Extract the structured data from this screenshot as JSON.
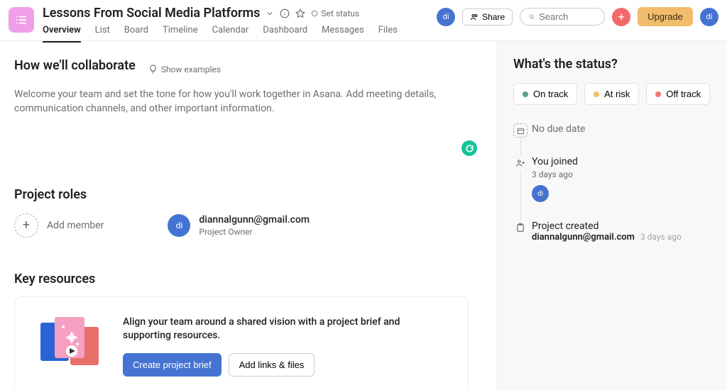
{
  "header": {
    "title": "Lessons From Social Media Platforms",
    "set_status": "Set status",
    "share": "Share",
    "search_placeholder": "Search",
    "upgrade": "Upgrade",
    "avatar_initials": "di"
  },
  "tabs": [
    "Overview",
    "List",
    "Board",
    "Timeline",
    "Calendar",
    "Dashboard",
    "Messages",
    "Files"
  ],
  "active_tab": 0,
  "collab": {
    "heading": "How we'll collaborate",
    "show_examples": "Show examples",
    "placeholder": "Welcome your team and set the tone for how you'll work together in Asana. Add meeting details, communication channels, and other important information."
  },
  "roles": {
    "heading": "Project roles",
    "add_member": "Add member",
    "members": [
      {
        "initials": "di",
        "email": "diannalgunn@gmail.com",
        "role": "Project Owner"
      }
    ]
  },
  "resources": {
    "heading": "Key resources",
    "blurb": "Align your team around a shared vision with a project brief and supporting resources.",
    "create_brief": "Create project brief",
    "add_links": "Add links & files"
  },
  "status": {
    "heading": "What's the status?",
    "options": [
      {
        "label": "On track",
        "color": "#58a182"
      },
      {
        "label": "At risk",
        "color": "#f1bd6c"
      },
      {
        "label": "Off track",
        "color": "#ef7872"
      }
    ],
    "timeline": {
      "no_due": "No due date",
      "joined_title": "You joined",
      "joined_ago": "3 days ago",
      "joined_initials": "di",
      "created_title": "Project created",
      "created_by": "diannalgunn@gmail.com",
      "created_ago": "3 days ago"
    }
  }
}
